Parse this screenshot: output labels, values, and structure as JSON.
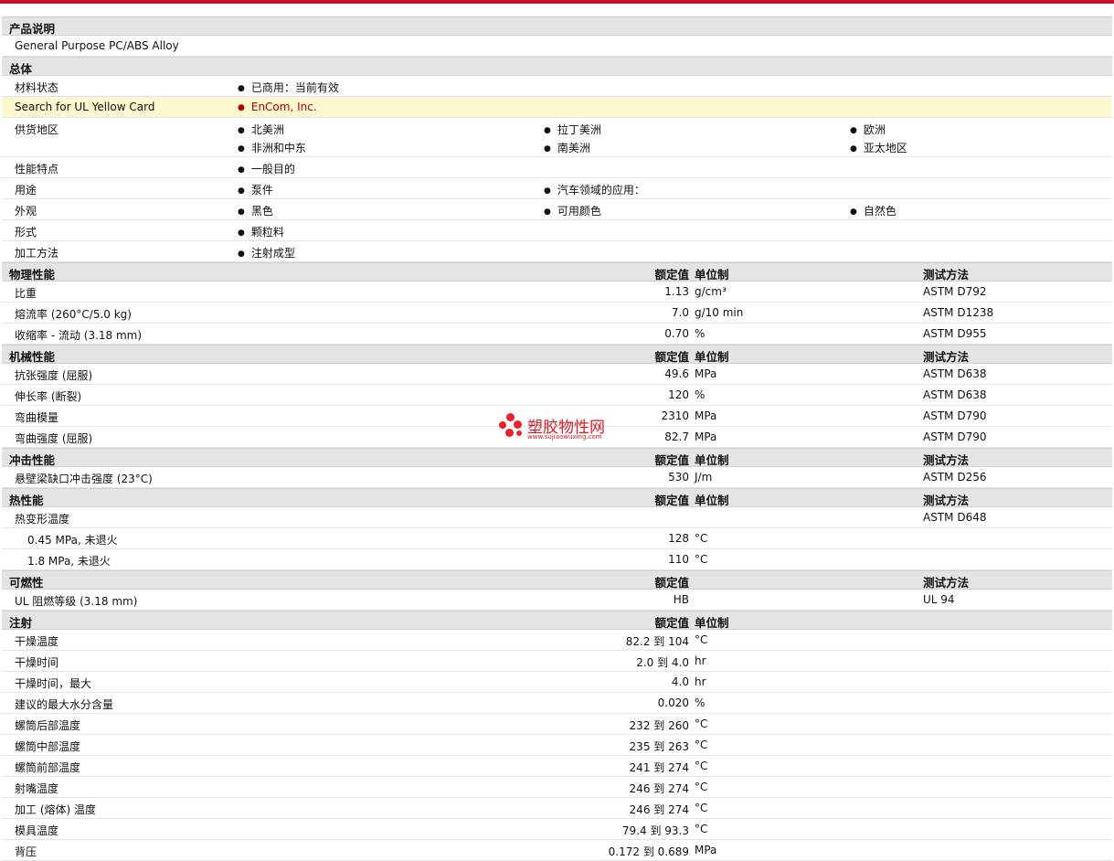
{
  "product_description": {
    "title": "产品说明",
    "text": "General Purpose PC/ABS Alloy"
  },
  "general": {
    "title": "总体",
    "rows": [
      {
        "label": "材料状态",
        "items": [
          "已商用：当前有效"
        ]
      },
      {
        "label": "Search for UL Yellow Card",
        "items": [
          "EnCom, Inc."
        ]
      },
      {
        "label": "供货地区",
        "items": [
          "北美洲",
          "拉丁美洲",
          "欧洲",
          "非洲和中东",
          "南美洲",
          "亚太地区"
        ]
      },
      {
        "label": "性能特点",
        "items": [
          "一般目的"
        ]
      },
      {
        "label": "用途",
        "items": [
          "泵件",
          "汽车领域的应用："
        ]
      },
      {
        "label": "外观",
        "items": [
          "黑色",
          "可用颜色",
          "自然色"
        ]
      },
      {
        "label": "形式",
        "items": [
          "颗粒料"
        ]
      },
      {
        "label": "加工方法",
        "items": [
          "注射成型"
        ]
      }
    ]
  },
  "headers": {
    "nominal": "额定值",
    "unit": "单位制",
    "test": "测试方法"
  },
  "physical": {
    "title": "物理性能",
    "rows": [
      {
        "label": "比重",
        "value": "1.13",
        "unit": "g/cm³",
        "test": "ASTM D792"
      },
      {
        "label": "熔流率 (260°C/5.0 kg)",
        "value": "7.0",
        "unit": "g/10 min",
        "test": "ASTM D1238"
      },
      {
        "label": "收缩率 - 流动 (3.18 mm)",
        "value": "0.70",
        "unit": "%",
        "test": "ASTM D955"
      }
    ]
  },
  "mechanical": {
    "title": "机械性能",
    "rows": [
      {
        "label": "抗张强度 (屈服)",
        "value": "49.6",
        "unit": "MPa",
        "test": "ASTM D638"
      },
      {
        "label": "伸长率 (断裂)",
        "value": "120",
        "unit": "%",
        "test": "ASTM D638"
      },
      {
        "label": "弯曲模量",
        "value": "2310",
        "unit": "MPa",
        "test": "ASTM D790"
      },
      {
        "label": "弯曲强度 (屈服)",
        "value": "82.7",
        "unit": "MPa",
        "test": "ASTM D790"
      }
    ]
  },
  "impact": {
    "title": "冲击性能",
    "rows": [
      {
        "label": "悬壁梁缺口冲击强度 (23°C)",
        "value": "530",
        "unit": "J/m",
        "test": "ASTM D256"
      }
    ]
  },
  "thermal": {
    "title": "热性能",
    "rows": [
      {
        "label": "热变形温度",
        "value": "",
        "unit": "",
        "test": "ASTM D648"
      },
      {
        "label": "0.45 MPa, 未退火",
        "value": "128",
        "unit": "°C",
        "test": ""
      },
      {
        "label": "1.8 MPa, 未退火",
        "value": "110",
        "unit": "°C",
        "test": ""
      }
    ]
  },
  "flammability": {
    "title": "可燃性",
    "rows": [
      {
        "label": "UL 阻燃等级 (3.18 mm)",
        "value": "HB",
        "unit": "",
        "test": "UL 94"
      }
    ]
  },
  "injection": {
    "title": "注射",
    "rows": [
      {
        "label": "干燥温度",
        "value": "82.2 到  104",
        "unit": "°C"
      },
      {
        "label": "干燥时间",
        "value": "2.0 到  4.0",
        "unit": "hr"
      },
      {
        "label": "干燥时间，最大",
        "value": "4.0",
        "unit": "hr"
      },
      {
        "label": "建议的最大水分含量",
        "value": "0.020",
        "unit": "%"
      },
      {
        "label": "螺筒后部温度",
        "value": "232 到  260",
        "unit": "°C"
      },
      {
        "label": "螺筒中部温度",
        "value": "235 到  263",
        "unit": "°C"
      },
      {
        "label": "螺筒前部温度",
        "value": "241 到  274",
        "unit": "°C"
      },
      {
        "label": "射嘴温度",
        "value": "246 到  274",
        "unit": "°C"
      },
      {
        "label": "加工 (熔体) 温度",
        "value": "246 到  274",
        "unit": "°C"
      },
      {
        "label": "模具温度",
        "value": "79.4 到  93.3",
        "unit": "°C"
      },
      {
        "label": "背压",
        "value": "0.172 到  0.689",
        "unit": "MPa"
      }
    ]
  },
  "watermark": {
    "name": "塑胶物性网",
    "url": "www.sujiaowuxing.com",
    "color": "#e8202a"
  }
}
